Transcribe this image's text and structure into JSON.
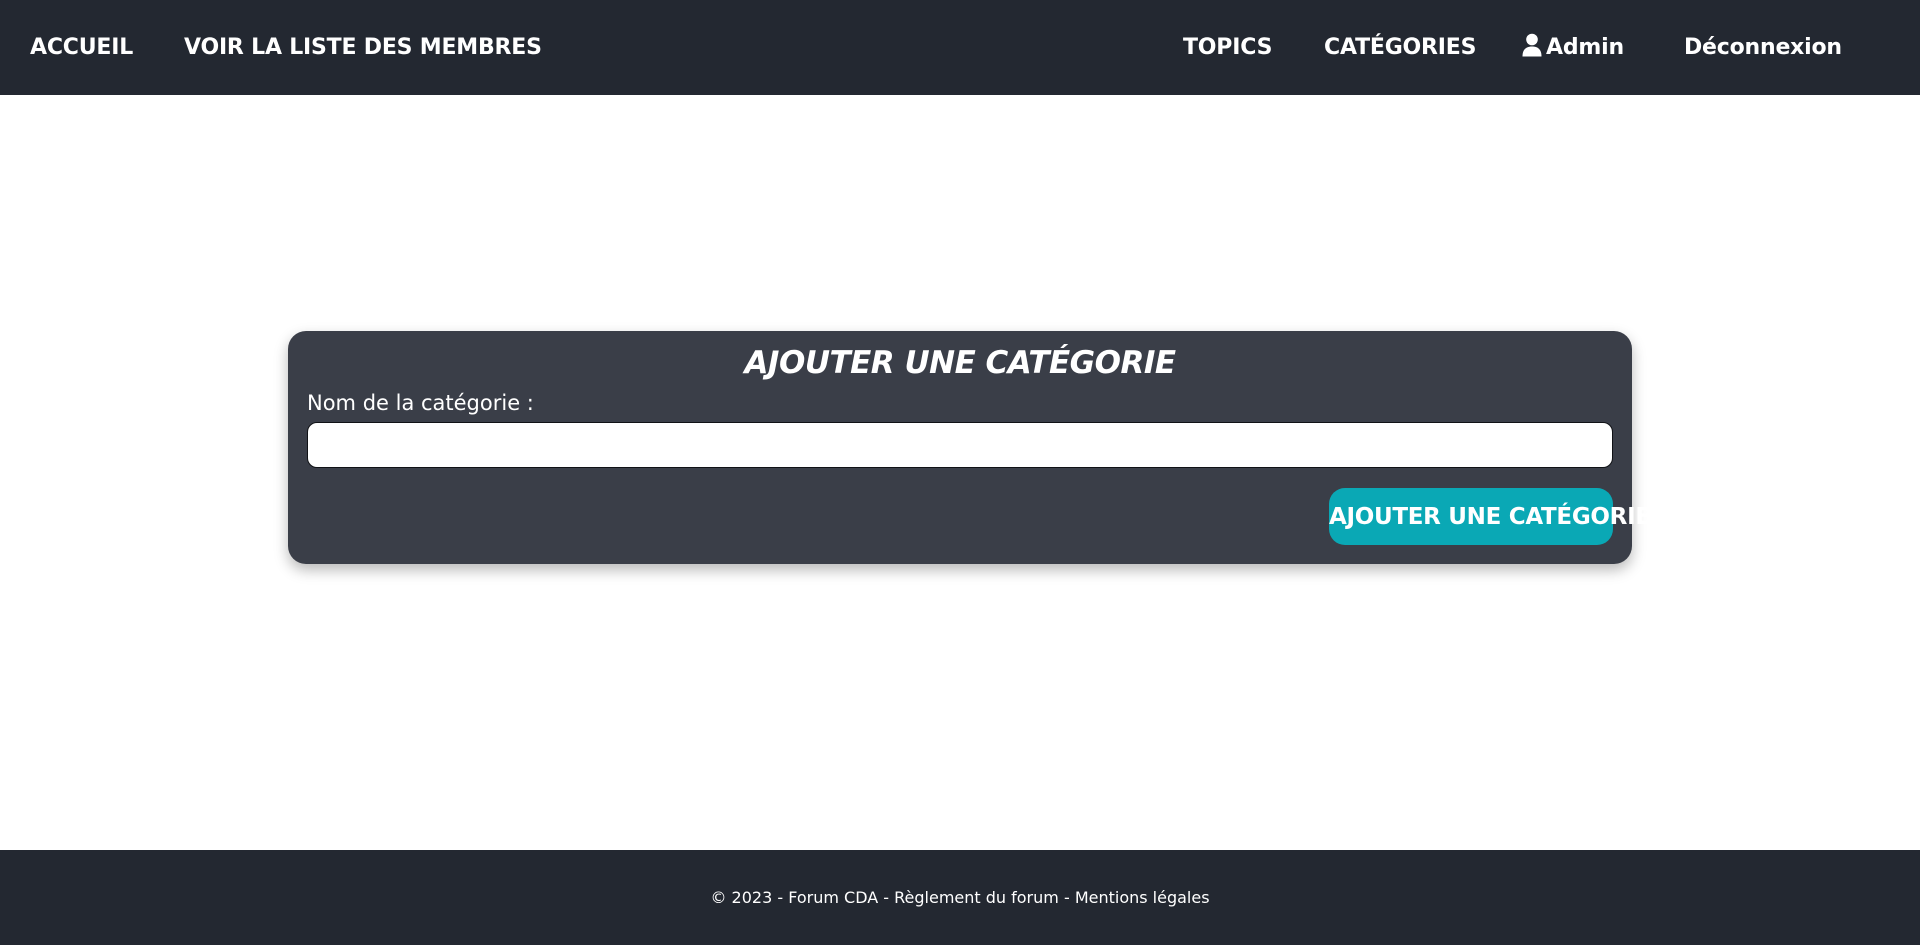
{
  "navbar": {
    "left_links": {
      "home": "ACCUEIL",
      "members": "VOIR LA LISTE DES MEMBRES"
    },
    "right_links": {
      "topics": "TOPICS",
      "categories": "CATÉGORIES",
      "admin": "Admin",
      "logout": "Déconnexion"
    },
    "icons": {
      "admin": "user-icon"
    },
    "background": "#232831"
  },
  "form": {
    "title": "AJOUTER UNE CATÉGORIE",
    "field_label": "Nom de la catégorie :",
    "field_value": "",
    "submit_label": "AJOUTER UNE CATÉGORIE",
    "card_background": "#3a3e48",
    "button_color": "#0aa8b5"
  },
  "footer": {
    "copyright": "© 2023 - Forum CDA - ",
    "rules": "Règlement du forum",
    "separator": " - ",
    "legal": "Mentions légales",
    "background": "#232831"
  }
}
